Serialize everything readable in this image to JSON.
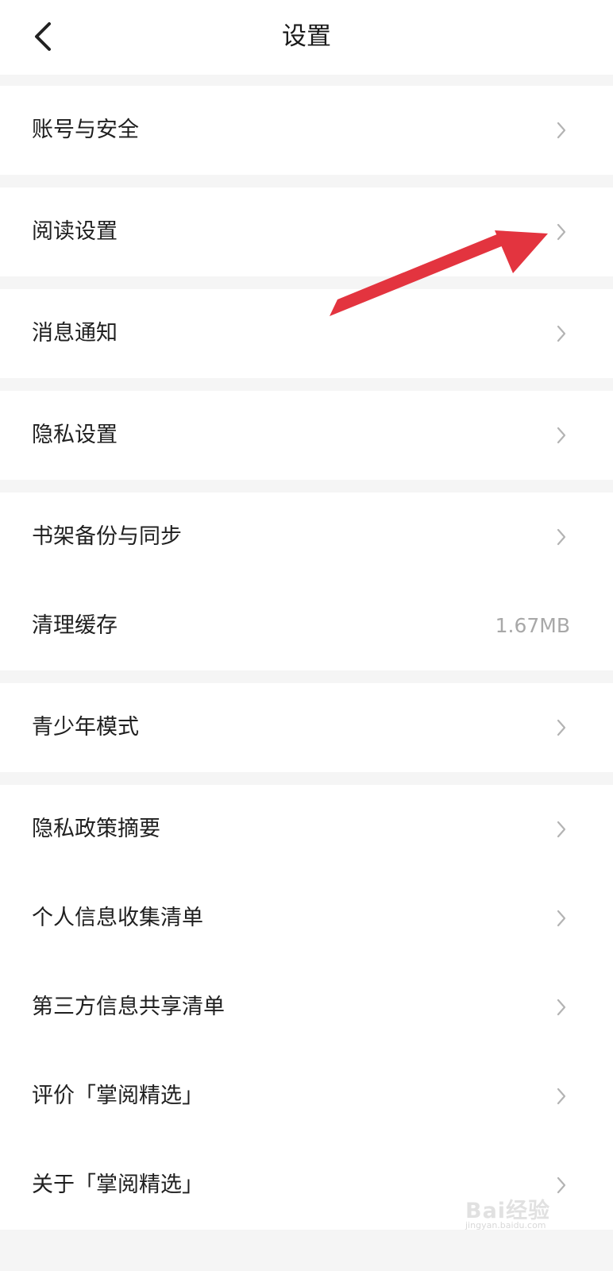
{
  "header": {
    "title": "设置",
    "back_icon": "chevron-left-icon"
  },
  "groups": [
    {
      "items": [
        {
          "label": "账号与安全",
          "chevron": true
        }
      ]
    },
    {
      "items": [
        {
          "label": "阅读设置",
          "chevron": true
        }
      ]
    },
    {
      "items": [
        {
          "label": "消息通知",
          "chevron": true
        }
      ]
    },
    {
      "items": [
        {
          "label": "隐私设置",
          "chevron": true
        }
      ]
    },
    {
      "items": [
        {
          "label": "书架备份与同步",
          "chevron": true
        },
        {
          "label": "清理缓存",
          "value": "1.67MB"
        }
      ]
    },
    {
      "items": [
        {
          "label": "青少年模式",
          "chevron": true
        }
      ]
    },
    {
      "items": [
        {
          "label": "隐私政策摘要",
          "chevron": true
        },
        {
          "label": "个人信息收集清单",
          "chevron": true
        },
        {
          "label": "第三方信息共享清单",
          "chevron": true
        },
        {
          "label": "评价「掌阅精选」",
          "chevron": true
        },
        {
          "label": "关于「掌阅精选」",
          "chevron": true
        }
      ]
    }
  ],
  "annotation": {
    "icon": "red-arrow-icon",
    "color": "#e3343f"
  },
  "watermark": {
    "text": "Bai",
    "brand_suffix": "经验",
    "url": "jingyan.baidu.com"
  },
  "colors": {
    "background": "#f5f5f5",
    "surface": "#ffffff",
    "text": "#1f1f1f",
    "secondary_text": "#a8a8a8",
    "chevron": "#b3b3b3"
  }
}
